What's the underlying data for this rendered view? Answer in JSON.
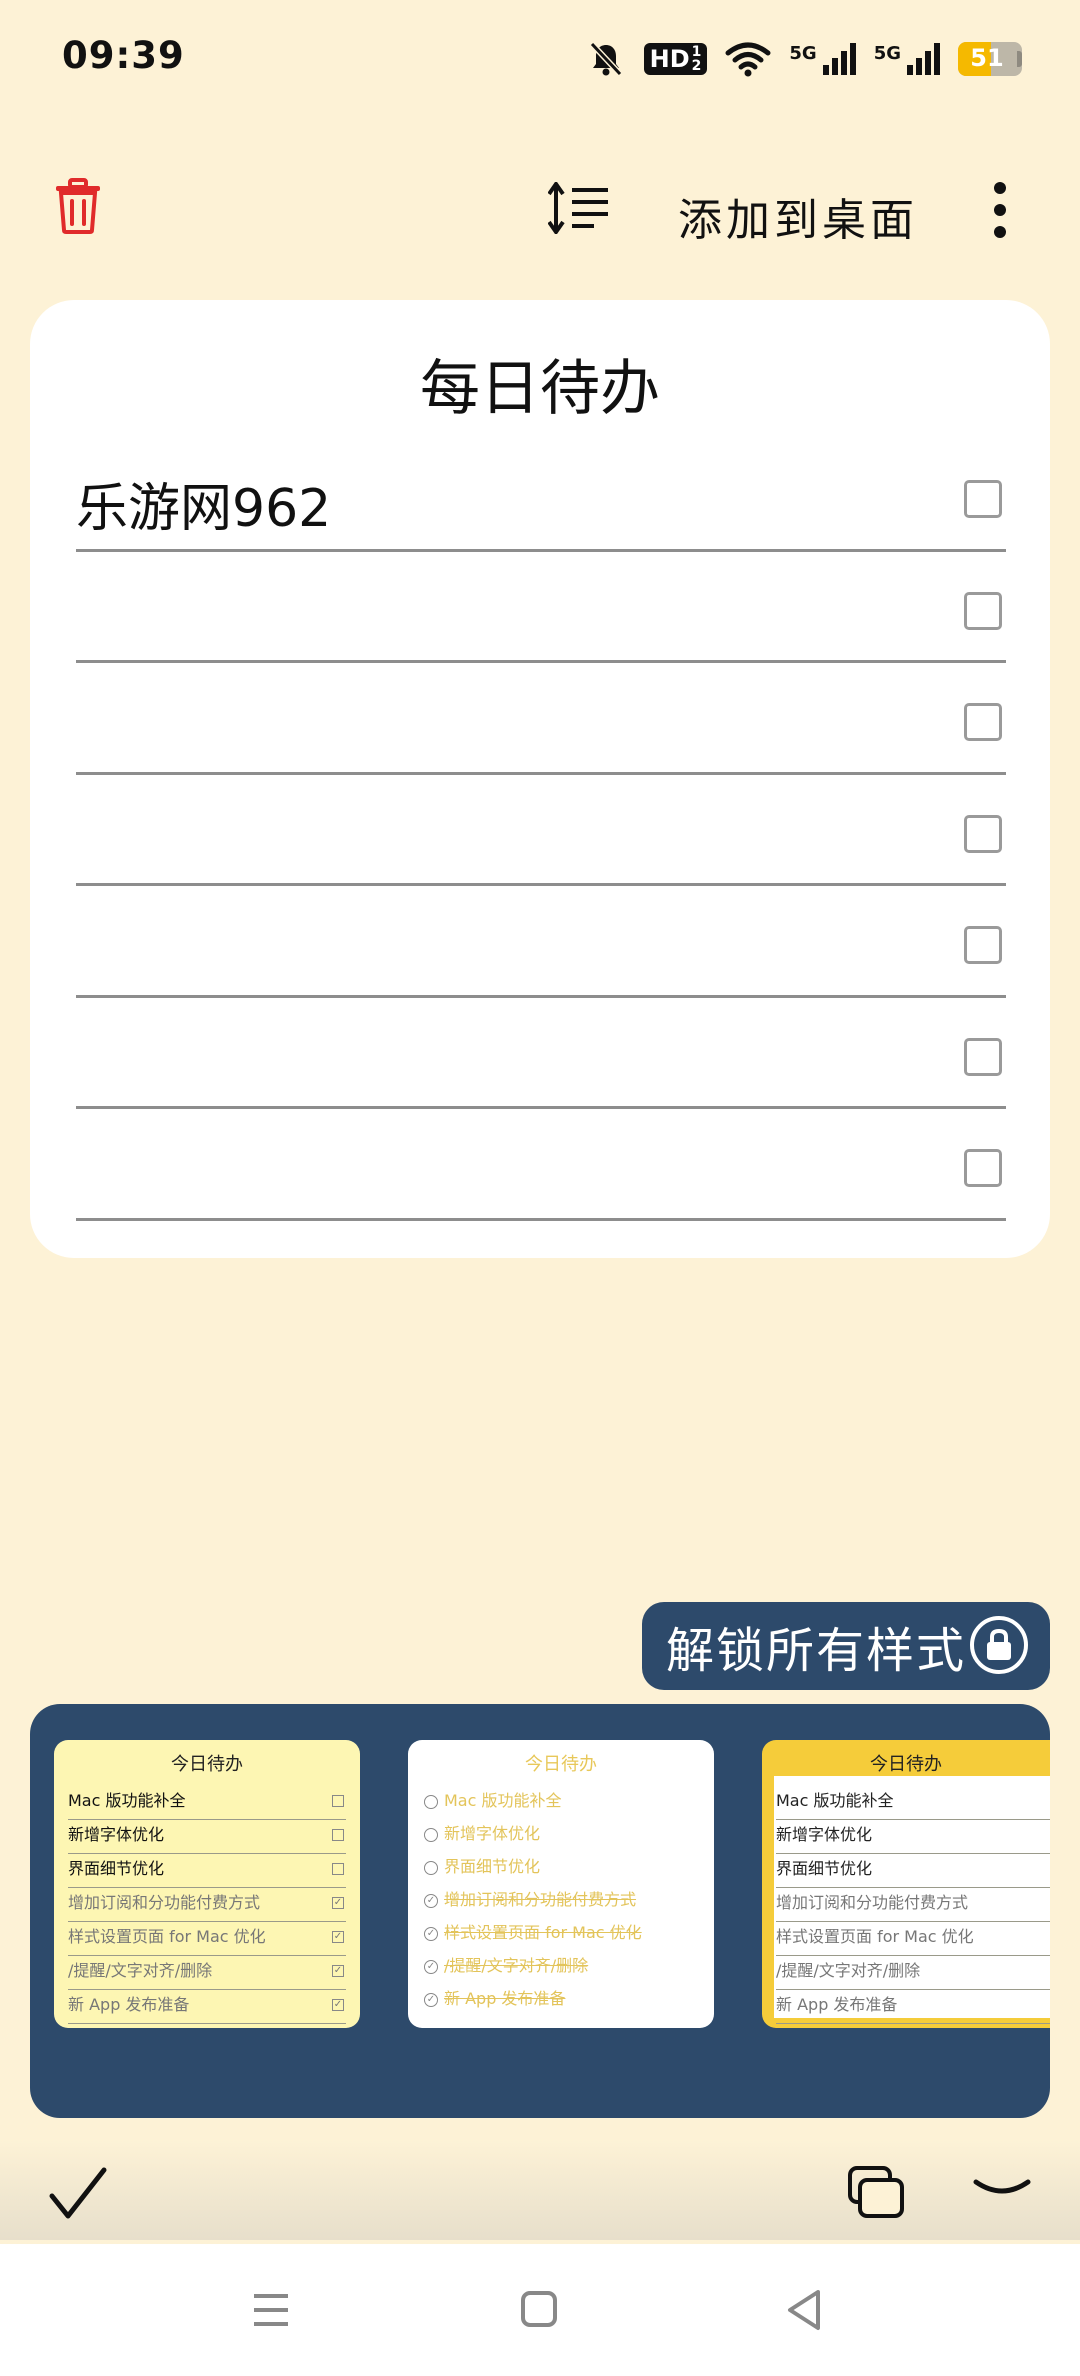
{
  "status_bar": {
    "time": "09:39",
    "hd_label": "HD",
    "hd_sub_top": "1",
    "hd_sub_bottom": "2",
    "net1_label": "5G",
    "net2_label": "5G",
    "battery_percent": "51",
    "battery_level": 0.51,
    "icons": [
      "bell-muted-icon",
      "hd-icon",
      "wifi-icon",
      "signal-5g-icon",
      "signal-5g-icon",
      "battery-icon"
    ]
  },
  "toolbar": {
    "delete_icon": "trash-icon",
    "sort_icon": "sort-lines-icon",
    "add_to_desktop": "添加到桌面",
    "more_icon": "more-vertical-icon"
  },
  "note": {
    "title": "每日待办",
    "rows": [
      {
        "text": "乐游网962",
        "checked": false
      },
      {
        "text": "",
        "checked": false
      },
      {
        "text": "",
        "checked": false
      },
      {
        "text": "",
        "checked": false
      },
      {
        "text": "",
        "checked": false
      },
      {
        "text": "",
        "checked": false
      },
      {
        "text": "",
        "checked": false
      }
    ]
  },
  "unlock": {
    "label": "解锁所有样式",
    "icon": "lock-icon"
  },
  "templates": {
    "t1": {
      "title": "今日待办",
      "items": [
        {
          "text": "Mac 版功能补全",
          "done": false
        },
        {
          "text": "新增字体优化",
          "done": false
        },
        {
          "text": "界面细节优化",
          "done": false
        },
        {
          "text": "增加订阅和分功能付费方式",
          "done": true
        },
        {
          "text": "样式设置页面 for Mac 优化",
          "done": true
        },
        {
          "text": "/提醒/文字对齐/删除",
          "done": true
        },
        {
          "text": "新 App 发布准备",
          "done": true
        }
      ]
    },
    "t2": {
      "title": "今日待办",
      "items": [
        {
          "text": "Mac 版功能补全",
          "done": false
        },
        {
          "text": "新增字体优化",
          "done": false
        },
        {
          "text": "界面细节优化",
          "done": false
        },
        {
          "text": "增加订阅和分功能付费方式",
          "done": true
        },
        {
          "text": "样式设置页面 for Mac 优化",
          "done": true
        },
        {
          "text": "/提醒/文字对齐/删除",
          "done": true
        },
        {
          "text": "新 App 发布准备",
          "done": true
        }
      ]
    },
    "t3": {
      "title": "今日待办",
      "items": [
        {
          "text": "Mac 版功能补全",
          "done": false
        },
        {
          "text": "新增字体优化",
          "done": false
        },
        {
          "text": "界面细节优化",
          "done": false
        },
        {
          "text": "增加订阅和分功能付费方式",
          "done": true
        },
        {
          "text": "样式设置页面 for Mac 优化",
          "done": true
        },
        {
          "text": "/提醒/文字对齐/删除",
          "done": true
        },
        {
          "text": "新 App 发布准备",
          "done": true
        }
      ]
    }
  },
  "bottom_bar": {
    "icons": [
      "checkmark-icon",
      "copy-windows-icon",
      "collapse-chevron-icon"
    ]
  },
  "nav_bar": {
    "icons": [
      "menu-icon",
      "home-icon",
      "back-icon"
    ]
  },
  "colors": {
    "background": "#fdf2d6",
    "panel": "#2d4a6b",
    "delete_red": "#e02b2b",
    "template_yellow": "#fdf6b3",
    "template_gold": "#f5cc3a"
  }
}
